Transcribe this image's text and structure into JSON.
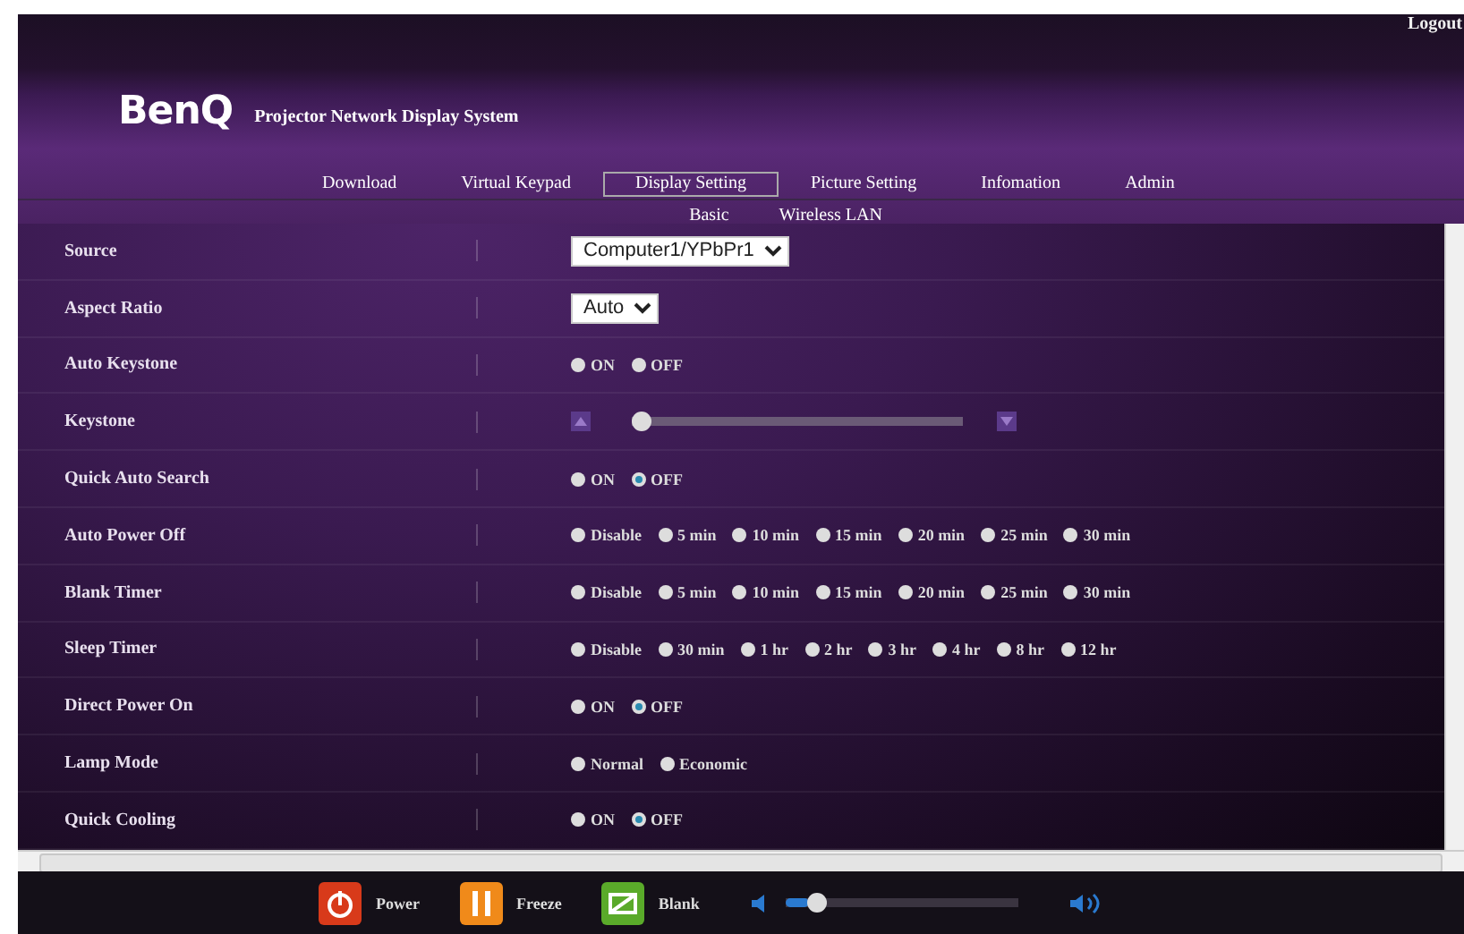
{
  "header": {
    "logout": "Logout",
    "logo": "BenQ",
    "title": "Projector Network Display System",
    "nav": [
      {
        "label": "Download",
        "selected": false
      },
      {
        "label": "Virtual Keypad",
        "selected": false
      },
      {
        "label": "Display Setting",
        "selected": true
      },
      {
        "label": "Picture Setting",
        "selected": false
      },
      {
        "label": "Infomation",
        "selected": false
      },
      {
        "label": "Admin",
        "selected": false
      }
    ],
    "subnav": [
      "Basic",
      "Wireless LAN"
    ]
  },
  "settings": [
    {
      "label": "Source",
      "kind": "select",
      "value": "Computer1/YPbPr1"
    },
    {
      "label": "Aspect Ratio",
      "kind": "select",
      "value": "Auto"
    },
    {
      "label": "Auto Keystone",
      "kind": "radio",
      "options": [
        {
          "label": "ON",
          "selected": false
        },
        {
          "label": "OFF",
          "selected": false
        }
      ]
    },
    {
      "label": "Keystone",
      "kind": "slider",
      "level": 0.0
    },
    {
      "label": "Quick Auto Search",
      "kind": "radio",
      "options": [
        {
          "label": "ON",
          "selected": false
        },
        {
          "label": "OFF",
          "selected": true
        }
      ]
    },
    {
      "label": "Auto Power Off",
      "kind": "radio",
      "options": [
        {
          "label": "Disable",
          "selected": false
        },
        {
          "label": "5 min",
          "selected": false
        },
        {
          "label": "10 min",
          "selected": false
        },
        {
          "label": "15 min",
          "selected": false
        },
        {
          "label": "20 min",
          "selected": false
        },
        {
          "label": "25 min",
          "selected": false
        },
        {
          "label": "30 min",
          "selected": false
        }
      ]
    },
    {
      "label": "Blank Timer",
      "kind": "radio",
      "options": [
        {
          "label": "Disable",
          "selected": false
        },
        {
          "label": "5 min",
          "selected": false
        },
        {
          "label": "10 min",
          "selected": false
        },
        {
          "label": "15 min",
          "selected": false
        },
        {
          "label": "20 min",
          "selected": false
        },
        {
          "label": "25 min",
          "selected": false
        },
        {
          "label": "30 min",
          "selected": false
        }
      ]
    },
    {
      "label": "Sleep Timer",
      "kind": "radio",
      "options": [
        {
          "label": "Disable",
          "selected": false
        },
        {
          "label": "30 min",
          "selected": false
        },
        {
          "label": "1 hr",
          "selected": false
        },
        {
          "label": "2 hr",
          "selected": false
        },
        {
          "label": "3 hr",
          "selected": false
        },
        {
          "label": "4 hr",
          "selected": false
        },
        {
          "label": "8 hr",
          "selected": false
        },
        {
          "label": "12 hr",
          "selected": false
        }
      ]
    },
    {
      "label": "Direct Power On",
      "kind": "radio",
      "options": [
        {
          "label": "ON",
          "selected": false
        },
        {
          "label": "OFF",
          "selected": true
        }
      ]
    },
    {
      "label": "Lamp Mode",
      "kind": "radio",
      "options": [
        {
          "label": "Normal",
          "selected": false
        },
        {
          "label": "Economic",
          "selected": false
        }
      ]
    },
    {
      "label": "Quick Cooling",
      "kind": "radio",
      "options": [
        {
          "label": "ON",
          "selected": false
        },
        {
          "label": "OFF",
          "selected": true
        }
      ]
    }
  ],
  "controls": {
    "buttons": [
      {
        "kind": "power",
        "label": "Power"
      },
      {
        "kind": "freeze",
        "label": "Freeze"
      },
      {
        "kind": "blank",
        "label": "Blank"
      }
    ],
    "volume": {
      "level": 0.1
    }
  }
}
